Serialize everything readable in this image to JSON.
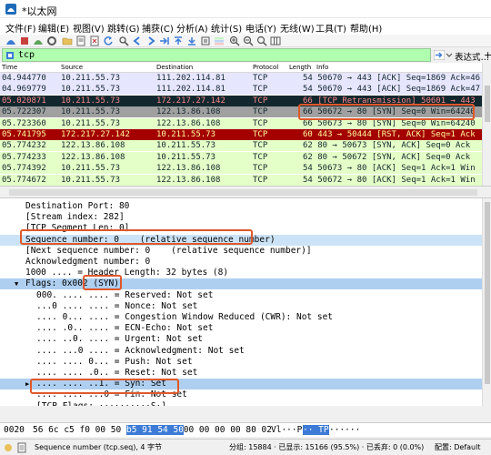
{
  "window": {
    "title": "*以太网"
  },
  "menu": [
    "文件(F)",
    "编辑(E)",
    "视图(V)",
    "跳转(G)",
    "捕获(C)",
    "分析(A)",
    "统计(S)",
    "电话(Y)",
    "无线(W)",
    "工具(T)",
    "帮助(H)"
  ],
  "filter": {
    "value": "tcp",
    "expression_label": "表达式…",
    "plus_label": "+"
  },
  "packet_list": {
    "columns": [
      "Time",
      "Source",
      "Destination",
      "Protocol",
      "Length",
      "Info"
    ],
    "rows": [
      {
        "time": "04.944770",
        "source": "10.211.55.73",
        "destination": "111.202.114.81",
        "protocol": "TCP",
        "info": "54 50670 → 443 [ACK] Seq=1869 Ack=46",
        "bg": "#e7e6ff",
        "fg": "#12272e"
      },
      {
        "time": "04.969779",
        "source": "10.211.55.73",
        "destination": "111.202.114.81",
        "protocol": "TCP",
        "info": "54 50670 → 443 [ACK] Seq=1869 Ack=47",
        "bg": "#e7e6ff",
        "fg": "#12272e"
      },
      {
        "time": "05.020871",
        "source": "10.211.55.73",
        "destination": "172.217.27.142",
        "protocol": "TCP",
        "info": "66 [TCP Retransmission] 50601 → 443",
        "bg": "#12272e",
        "fg": "#f78787"
      },
      {
        "time": "05.722307",
        "source": "10.211.55.73",
        "destination": "122.13.86.108",
        "protocol": "TCP",
        "info": "66 50672 → 80 [SYN] Seq=0 Win=64240",
        "bg": "#a0a0a0",
        "fg": "#12272e"
      },
      {
        "time": "05.723360",
        "source": "10.211.55.73",
        "destination": "122.13.86.108",
        "protocol": "TCP",
        "info": "66 50673 → 80 [SYN] Seq=0 Win=64240",
        "bg": "#e4ffc7",
        "fg": "#12272e"
      },
      {
        "time": "05.741795",
        "source": "172.217.27.142",
        "destination": "10.211.55.73",
        "protocol": "TCP",
        "info": "60 443 → 50444 [RST, ACK] Seq=1 Ack",
        "bg": "#a40000",
        "fg": "#fffc9c"
      },
      {
        "time": "05.774232",
        "source": "122.13.86.108",
        "destination": "10.211.55.73",
        "protocol": "TCP",
        "info": "62 80 → 50673 [SYN, ACK] Seq=0 Ack",
        "bg": "#e4ffc7",
        "fg": "#12272e"
      },
      {
        "time": "05.774233",
        "source": "122.13.86.108",
        "destination": "10.211.55.73",
        "protocol": "TCP",
        "info": "62 80 → 50672 [SYN, ACK] Seq=0 Ack",
        "bg": "#e4ffc7",
        "fg": "#12272e"
      },
      {
        "time": "05.774392",
        "source": "10.211.55.73",
        "destination": "122.13.86.108",
        "protocol": "TCP",
        "info": "54 50673 → 80 [ACK] Seq=1 Ack=1 Win",
        "bg": "#e4ffc7",
        "fg": "#12272e"
      },
      {
        "time": "05.774672",
        "source": "10.211.55.73",
        "destination": "122.13.86.108",
        "protocol": "TCP",
        "info": "54 50672 → 80 [ACK] Seq=1 Ack=1 Win",
        "bg": "#e4ffc7",
        "fg": "#12272e"
      }
    ]
  },
  "details": [
    {
      "text": "Destination Port: 80",
      "sel": false
    },
    {
      "text": "[Stream index: 282]",
      "sel": false
    },
    {
      "text": "[TCP Segment Len: 0]",
      "sel": false
    },
    {
      "text": "Sequence number: 0    (relative sequence number)",
      "sel": true
    },
    {
      "text": "[Next sequence number: 0    (relative sequence number)]",
      "sel": false
    },
    {
      "text": "Acknowledgment number: 0",
      "sel": false
    },
    {
      "text": "1000 .... = Header Length: 32 bytes (8)",
      "sel": false
    },
    {
      "text": "Flags: 0x002 (SYN)",
      "sel": true,
      "arrow": "▼"
    },
    {
      "text": "000. .... .... = Reserved: Not set",
      "sel": false
    },
    {
      "text": "...0 .... .... = Nonce: Not set",
      "sel": false
    },
    {
      "text": ".... 0... .... = Congestion Window Reduced (CWR): Not set",
      "sel": false
    },
    {
      "text": ".... .0.. .... = ECN-Echo: Not set",
      "sel": false
    },
    {
      "text": ".... ..0. .... = Urgent: Not set",
      "sel": false
    },
    {
      "text": ".... ...0 .... = Acknowledgment: Not set",
      "sel": false
    },
    {
      "text": ".... .... 0... = Push: Not set",
      "sel": false
    },
    {
      "text": ".... .... .0.. = Reset: Not set",
      "sel": false
    },
    {
      "text": ".... .... ..1. = Syn: Set",
      "sel": true,
      "arrow": "▶"
    },
    {
      "text": ".... .... ...0 = Fin: Not set",
      "sel": false
    },
    {
      "text": "[TCP Flags: ··········S·]",
      "sel": false
    }
  ],
  "bytes": {
    "offset": "0020",
    "pre": "56 6c c5 f0 00 50 ",
    "sel": "b5 91 54 50",
    "post": " 00 00 00 00 80 02",
    "ascii_pre": "Vl···P",
    "ascii_sel": "·· TP",
    "ascii_post": "······"
  },
  "status": {
    "field": "Sequence number (tcp.seq), 4 字节",
    "packets": "分组: 15884 · 已显示: 15166 (95.5%) · 已丢弃: 0 (0.0%)",
    "profile": "配置: Default"
  }
}
